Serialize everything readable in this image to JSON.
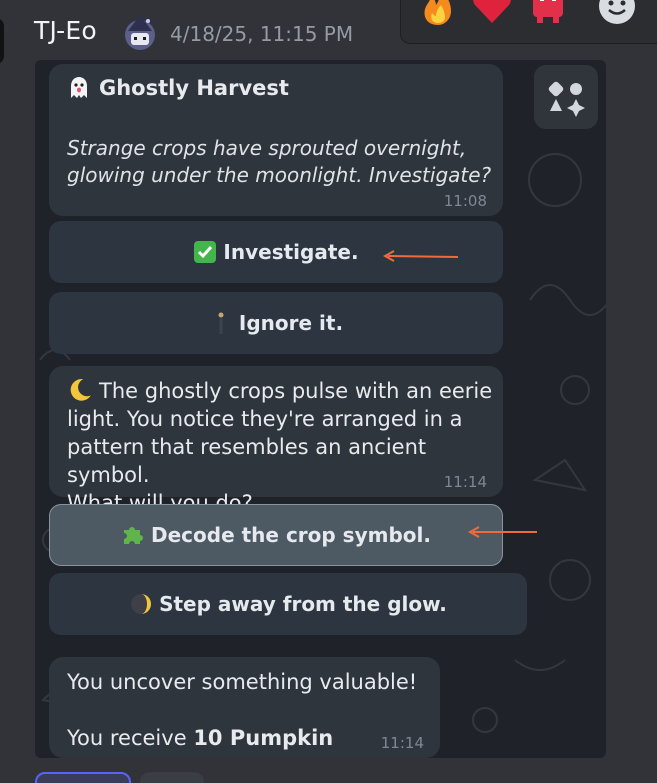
{
  "message": {
    "author": "TJ-Eo",
    "timestamp": "4/18/25, 11:15 PM"
  },
  "reactions": [
    {
      "icon": "fire-emoji-icon"
    },
    {
      "icon": "red-heart-icon"
    },
    {
      "icon": "red-pixel-emoji-icon"
    },
    {
      "icon": "add-reaction-smile-icon"
    }
  ],
  "chat": {
    "bubble1": {
      "title": "Ghostly Harvest",
      "title_icon": "ghost-emoji-icon",
      "line1": "Strange crops have sprouted overnight,",
      "line2": "glowing under the moonlight. Investigate?",
      "time": "11:08"
    },
    "buttons": [
      {
        "label": "Investigate.",
        "icon": "check-mark-button-icon"
      },
      {
        "label": "Ignore it.",
        "icon": "person-walking-icon"
      }
    ],
    "bubble2": {
      "line1": "The ghostly crops pulse with an eerie",
      "line2": "light. You notice they're arranged in a",
      "line3": "pattern that resembles an ancient symbol.",
      "line4": "What will you do?",
      "icon": "crescent-moon-icon",
      "time": "11:14"
    },
    "buttons2": [
      {
        "label": "Decode the crop symbol.",
        "icon": "puzzle-piece-icon"
      },
      {
        "label": "Step away from the glow.",
        "icon": "dark-moon-icon"
      }
    ],
    "bubble3": {
      "line1": "You uncover something valuable!",
      "line2_prefix": "You receive",
      "line2_bold": "10 Pumpkin",
      "time": "11:14"
    }
  },
  "colors": {
    "background": "#323339",
    "embed_bg": "#1f2329",
    "bubble": "#2e353d",
    "button": "#2c3540",
    "button_selected": "#4e5a63",
    "arrow": "#f06a3c"
  }
}
